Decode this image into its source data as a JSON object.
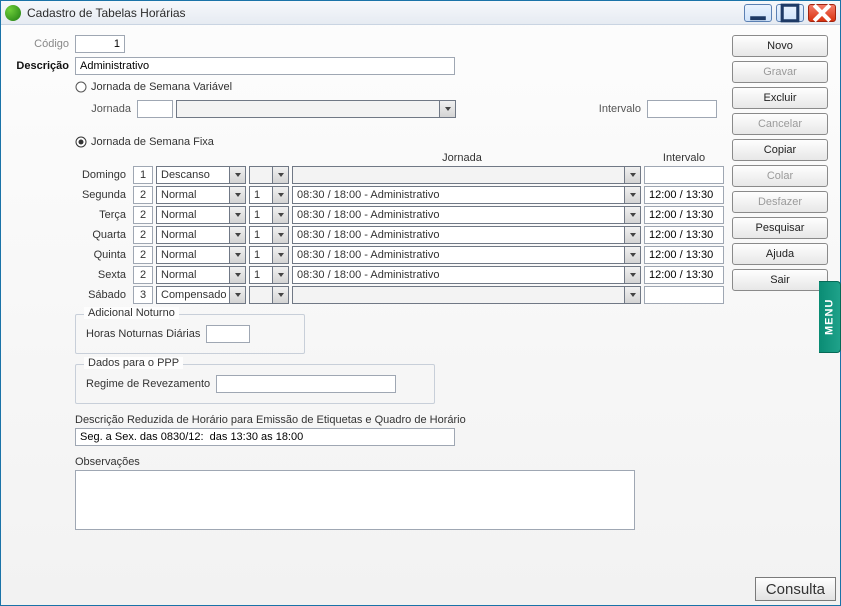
{
  "window": {
    "title": "Cadastro de Tabelas Horárias"
  },
  "labels": {
    "codigo": "Código",
    "descricao": "Descrição",
    "jornada_var": "Jornada de Semana Variável",
    "jornada_fixa": "Jornada de Semana Fixa",
    "jornada": "Jornada",
    "intervalo": "Intervalo",
    "adicional": "Adicional Noturno",
    "horas_noturnas": "Horas Noturnas Diárias",
    "ppp": "Dados para o PPP",
    "regime": "Regime de Revezamento",
    "descr_reduz": "Descrição Reduzida de Horário para Emissão de Etiquetas e Quadro de Horário",
    "observacoes": "Observações"
  },
  "fields": {
    "codigo": "1",
    "descricao": "Administrativo",
    "jornada_code": "",
    "jornada_select": "",
    "intervalo_var": "",
    "horas_noturnas": "",
    "regime": "",
    "descr_reduz": "Seg. a Sex. das 0830/12:  das 13:30 as 18:00",
    "observacoes": ""
  },
  "radio_selected": "fixa",
  "days": [
    {
      "label": "Domingo",
      "num": "1",
      "type": "Descanso",
      "code": "",
      "sched": "",
      "interval": ""
    },
    {
      "label": "Segunda",
      "num": "2",
      "type": "Normal",
      "code": "1",
      "sched": "08:30 / 18:00 - Administrativo",
      "interval": "12:00 / 13:30"
    },
    {
      "label": "Terça",
      "num": "2",
      "type": "Normal",
      "code": "1",
      "sched": "08:30 / 18:00 - Administrativo",
      "interval": "12:00 / 13:30"
    },
    {
      "label": "Quarta",
      "num": "2",
      "type": "Normal",
      "code": "1",
      "sched": "08:30 / 18:00 - Administrativo",
      "interval": "12:00 / 13:30"
    },
    {
      "label": "Quinta",
      "num": "2",
      "type": "Normal",
      "code": "1",
      "sched": "08:30 / 18:00 - Administrativo",
      "interval": "12:00 / 13:30"
    },
    {
      "label": "Sexta",
      "num": "2",
      "type": "Normal",
      "code": "1",
      "sched": "08:30 / 18:00 - Administrativo",
      "interval": "12:00 / 13:30"
    },
    {
      "label": "Sábado",
      "num": "3",
      "type": "Compensado",
      "code": "",
      "sched": "",
      "interval": ""
    }
  ],
  "buttons": {
    "novo": "Novo",
    "gravar": "Gravar",
    "excluir": "Excluir",
    "cancelar": "Cancelar",
    "copiar": "Copiar",
    "colar": "Colar",
    "desfazer": "Desfazer",
    "pesquisar": "Pesquisar",
    "ajuda": "Ajuda",
    "sair": "Sair",
    "consulta": "Consulta",
    "menu": "MENU"
  },
  "button_states": {
    "novo": true,
    "gravar": false,
    "excluir": true,
    "cancelar": false,
    "copiar": true,
    "colar": false,
    "desfazer": false,
    "pesquisar": true,
    "ajuda": true,
    "sair": true
  }
}
